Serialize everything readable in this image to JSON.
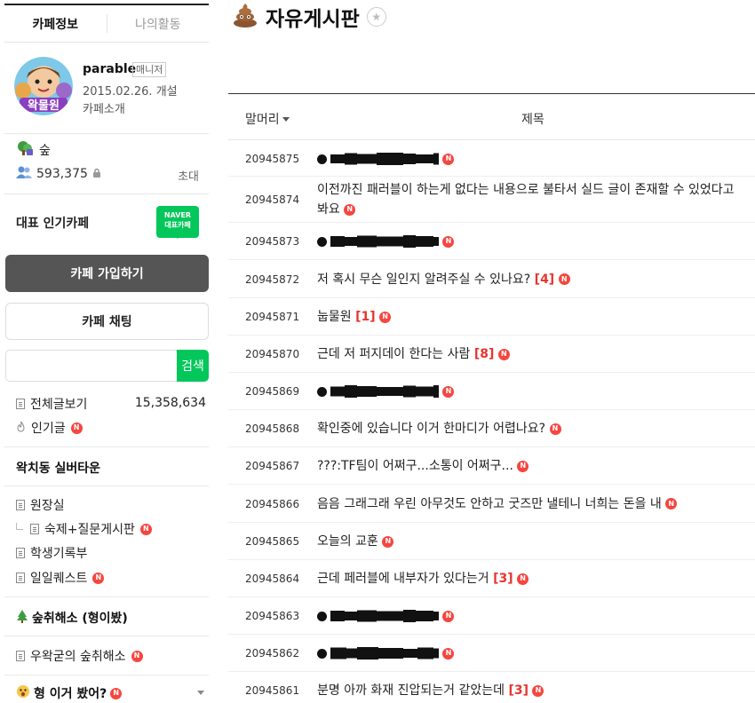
{
  "sidebar": {
    "tabs": [
      "카페정보",
      "나의활동"
    ],
    "profile": {
      "name": "parable",
      "badge": "매니저",
      "founded": "2015.02.26. 개설",
      "intro": "카페소개",
      "avatar_text": "왁물원"
    },
    "grade": "숲",
    "members": "593,375",
    "invite": "초대",
    "rep_label": "대표 인기카페",
    "naver_badge": [
      "NAVER",
      "대표카페"
    ],
    "join_button": "카페 가입하기",
    "chat_button": "카페 채팅",
    "search": {
      "placeholder": "",
      "button": "검색"
    },
    "all_posts": {
      "label": "전체글보기",
      "count": "15,358,634"
    },
    "popular": "인기글",
    "section1": "왁치동 실버타운",
    "menu1": [
      "원장실",
      "숙제+질문게시판",
      "학생기록부",
      "일일퀘스트"
    ],
    "section2": "숲취해소 (형이봤)",
    "menu2": [
      "우왁굳의 숲취해소"
    ],
    "section3": "형 이거 봤어?",
    "new_badge": "N"
  },
  "main": {
    "title": "자유게시판",
    "col_head": "말머리",
    "col_title": "제목",
    "rows": [
      {
        "no": "20945875",
        "title": "",
        "comments": "",
        "redacted": true
      },
      {
        "no": "20945874",
        "title": "이전까진 패러블이 하는게 없다는 내용으로 불타서 실드 글이 존재할 수 있었다고 봐요",
        "comments": "",
        "redacted": false
      },
      {
        "no": "20945873",
        "title": "",
        "comments": "",
        "redacted": true
      },
      {
        "no": "20945872",
        "title": "저 혹시 무슨 일인지 알려주실 수 있나요?",
        "comments": "[4]",
        "redacted": false
      },
      {
        "no": "20945871",
        "title": "눕물원",
        "comments": "[1]",
        "redacted": false
      },
      {
        "no": "20945870",
        "title": "근데 저 퍼지데이 한다는 사람",
        "comments": "[8]",
        "redacted": false
      },
      {
        "no": "20945869",
        "title": "",
        "comments": "",
        "redacted": true
      },
      {
        "no": "20945868",
        "title": "확인중에 있습니다 이거 한마디가 어렵나요?",
        "comments": "",
        "redacted": false
      },
      {
        "no": "20945867",
        "title": "???:TF팀이 어쩌구...소통이 어쩌구...",
        "comments": "",
        "redacted": false
      },
      {
        "no": "20945866",
        "title": "음음 그래그래 우린 아무것도 안하고 굿즈만 낼테니 너희는 돈을 내",
        "comments": "",
        "redacted": false
      },
      {
        "no": "20945865",
        "title": "오늘의 교훈",
        "comments": "",
        "redacted": false
      },
      {
        "no": "20945864",
        "title": "근데 페러블에 내부자가 있다는거",
        "comments": "[3]",
        "redacted": false
      },
      {
        "no": "20945863",
        "title": "",
        "comments": "",
        "redacted": true
      },
      {
        "no": "20945862",
        "title": "",
        "comments": "",
        "redacted": true
      },
      {
        "no": "20945861",
        "title": "분명 아까 화재 진압되는거 같았는데",
        "comments": "[3]",
        "redacted": false
      }
    ]
  },
  "colors": {
    "accent": "#03c75a",
    "new_badge": "#f5463f",
    "comment_count": "#e5362e",
    "join_button": "#555555"
  }
}
